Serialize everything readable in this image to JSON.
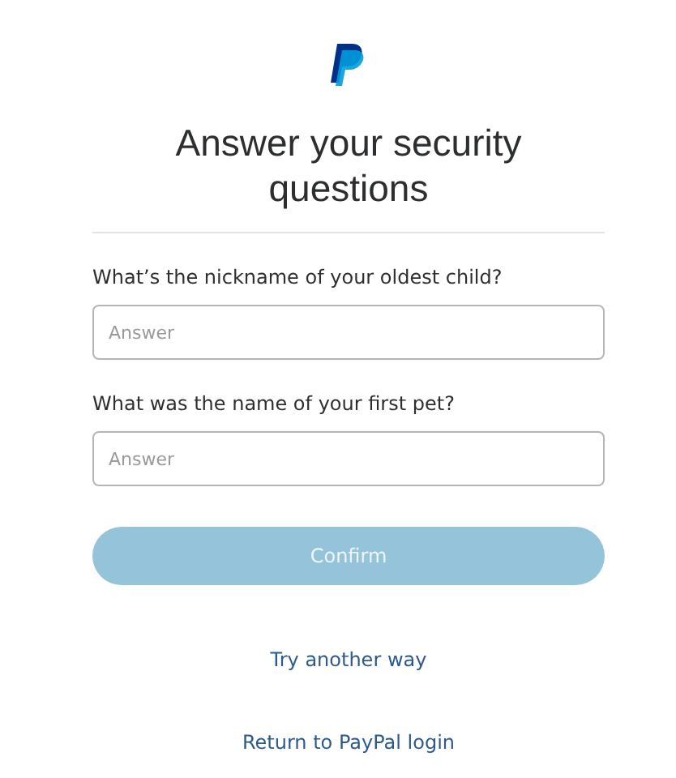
{
  "title": "Answer your security questions",
  "questions": [
    {
      "label": "What’s the nickname of your oldest child?",
      "placeholder": "Answer"
    },
    {
      "label": "What was the name of your first pet?",
      "placeholder": "Answer"
    }
  ],
  "confirm": {
    "label": "Confirm",
    "disabled": true
  },
  "links": [
    "Try another way",
    "Return to PayPal login"
  ]
}
